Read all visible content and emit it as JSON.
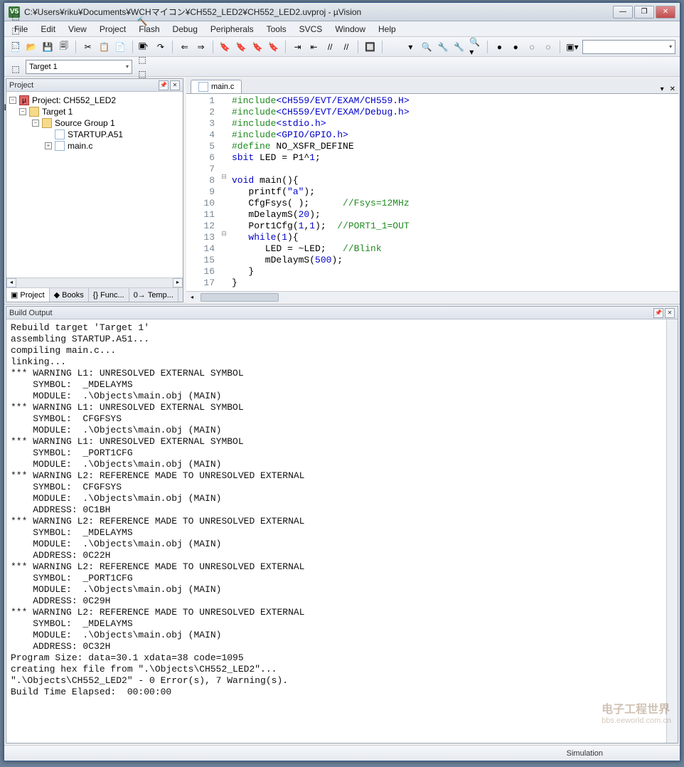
{
  "window": {
    "app_icon_text": "V5",
    "title": "C:¥Users¥riku¥Documents¥WCHマイコン¥CH552_LED2¥CH552_LED2.uvproj - µVision",
    "min": "—",
    "max": "❐",
    "close": "✕"
  },
  "menu": [
    "File",
    "Edit",
    "View",
    "Project",
    "Flash",
    "Debug",
    "Peripherals",
    "Tools",
    "SVCS",
    "Window",
    "Help"
  ],
  "toolbar1_icons": [
    "📄",
    "📂",
    "💾",
    "🗐",
    "|",
    "✂",
    "📋",
    "📄",
    "|",
    "↶",
    "↷",
    "|",
    "⇐",
    "⇒",
    "|",
    "🔖",
    "🔖",
    "🔖",
    "🔖",
    "|",
    "⇥",
    "⇤",
    "//",
    "//",
    "|",
    "🔲",
    "|",
    " ",
    "▾",
    "🔍",
    "🔧",
    "🔧",
    "🔍▾",
    "|",
    "●",
    "●",
    "◌",
    "◌",
    "|",
    "▣▾"
  ],
  "toolbar2": {
    "icons_left": [
      "⬚",
      "⬚",
      "⬚",
      "|",
      "⬚",
      "|",
      "⤓",
      "LOAD",
      "|"
    ],
    "target_label": "Target 1",
    "icons_right": [
      "🔨",
      "|",
      "▣",
      "⬚",
      "⬚",
      "|",
      "⬚",
      "⬚"
    ]
  },
  "project_panel": {
    "title": "Project",
    "root": "Project: CH552_LED2",
    "target": "Target 1",
    "group": "Source Group 1",
    "files": [
      "STARTUP.A51",
      "main.c"
    ],
    "tabs": [
      {
        "icon": "▣",
        "label": "Project"
      },
      {
        "icon": "◆",
        "label": "Books"
      },
      {
        "icon": "{}",
        "label": "Func..."
      },
      {
        "icon": "0→",
        "label": "Temp..."
      }
    ]
  },
  "editor": {
    "tab_label": "main.c",
    "lines": [
      {
        "n": 1,
        "html": "<span class='kw-inc'>#include</span><span class='kw-str'>&lt;CH559/EVT/EXAM/CH559.H&gt;</span>"
      },
      {
        "n": 2,
        "html": "<span class='kw-inc'>#include</span><span class='kw-str'>&lt;CH559/EVT/EXAM/Debug.h&gt;</span>"
      },
      {
        "n": 3,
        "html": "<span class='kw-inc'>#include</span><span class='kw-str'>&lt;stdio.h&gt;</span>"
      },
      {
        "n": 4,
        "html": "<span class='kw-inc'>#include</span><span class='kw-str'>&lt;GPIO/GPIO.h&gt;</span>"
      },
      {
        "n": 5,
        "html": "<span class='kw-inc'>#define</span> NO_XSFR_DEFINE"
      },
      {
        "n": 6,
        "html": "<span class='kw-blue'>sbit</span> LED = P1^<span class='kw-num'>1</span>;"
      },
      {
        "n": 7,
        "html": ""
      },
      {
        "n": 8,
        "fold": "⊟",
        "html": "<span class='kw-blue'>void</span> main(){"
      },
      {
        "n": 9,
        "html": "   printf(<span class='kw-str'>\"a\"</span>);"
      },
      {
        "n": 10,
        "html": "   CfgFsys( );      <span class='kw-cmt'>//Fsys=12MHz</span>"
      },
      {
        "n": 11,
        "html": "   mDelaymS(<span class='kw-num'>20</span>);"
      },
      {
        "n": 12,
        "html": "   Port1Cfg(<span class='kw-num'>1</span>,<span class='kw-num'>1</span>);  <span class='kw-cmt'>//PORT1_1=OUT</span>"
      },
      {
        "n": 13,
        "fold": "⊟",
        "html": "   <span class='kw-blue'>while</span>(<span class='kw-num'>1</span>){"
      },
      {
        "n": 14,
        "html": "      LED = ~LED;   <span class='kw-cmt'>//Blink</span>"
      },
      {
        "n": 15,
        "html": "      mDelaymS(<span class='kw-num'>500</span>);"
      },
      {
        "n": 16,
        "html": "   }"
      },
      {
        "n": 17,
        "html": "}"
      }
    ]
  },
  "build_output": {
    "title": "Build Output",
    "text": "Rebuild target 'Target 1'\nassembling STARTUP.A51...\ncompiling main.c...\nlinking...\n*** WARNING L1: UNRESOLVED EXTERNAL SYMBOL\n    SYMBOL:  _MDELAYMS\n    MODULE:  .\\Objects\\main.obj (MAIN)\n*** WARNING L1: UNRESOLVED EXTERNAL SYMBOL\n    SYMBOL:  CFGFSYS\n    MODULE:  .\\Objects\\main.obj (MAIN)\n*** WARNING L1: UNRESOLVED EXTERNAL SYMBOL\n    SYMBOL:  _PORT1CFG\n    MODULE:  .\\Objects\\main.obj (MAIN)\n*** WARNING L2: REFERENCE MADE TO UNRESOLVED EXTERNAL\n    SYMBOL:  CFGFSYS\n    MODULE:  .\\Objects\\main.obj (MAIN)\n    ADDRESS: 0C1BH\n*** WARNING L2: REFERENCE MADE TO UNRESOLVED EXTERNAL\n    SYMBOL:  _MDELAYMS\n    MODULE:  .\\Objects\\main.obj (MAIN)\n    ADDRESS: 0C22H\n*** WARNING L2: REFERENCE MADE TO UNRESOLVED EXTERNAL\n    SYMBOL:  _PORT1CFG\n    MODULE:  .\\Objects\\main.obj (MAIN)\n    ADDRESS: 0C29H\n*** WARNING L2: REFERENCE MADE TO UNRESOLVED EXTERNAL\n    SYMBOL:  _MDELAYMS\n    MODULE:  .\\Objects\\main.obj (MAIN)\n    ADDRESS: 0C32H\nProgram Size: data=30.1 xdata=38 code=1095\ncreating hex file from \".\\Objects\\CH552_LED2\"...\n\".\\Objects\\CH552_LED2\" - 0 Error(s), 7 Warning(s).\nBuild Time Elapsed:  00:00:00"
  },
  "statusbar": {
    "mode": "Simulation"
  },
  "watermark": {
    "big": "电子工程世界",
    "small": "bbs.eeworld.com.cn"
  }
}
